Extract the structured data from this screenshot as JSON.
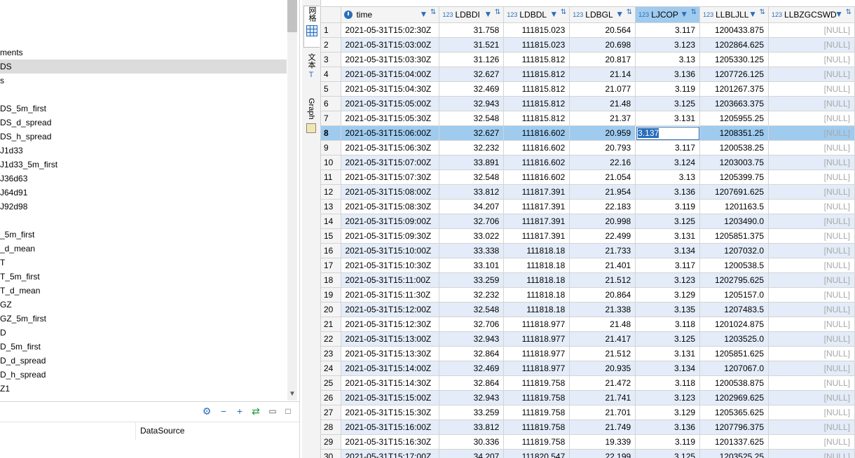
{
  "navigator": {
    "items": [
      {
        "label": "ments",
        "selected": false
      },
      {
        "label": "DS",
        "selected": true
      },
      {
        "label": "s",
        "selected": false
      },
      {
        "label": "",
        "selected": false
      },
      {
        "label": "DS_5m_first",
        "selected": false
      },
      {
        "label": "DS_d_spread",
        "selected": false
      },
      {
        "label": "DS_h_spread",
        "selected": false
      },
      {
        "label": "J1d33",
        "selected": false
      },
      {
        "label": "J1d33_5m_first",
        "selected": false
      },
      {
        "label": "J36d63",
        "selected": false
      },
      {
        "label": "J64d91",
        "selected": false
      },
      {
        "label": "J92d98",
        "selected": false
      },
      {
        "label": "",
        "selected": false
      },
      {
        "label": "_5m_first",
        "selected": false
      },
      {
        "label": "_d_mean",
        "selected": false
      },
      {
        "label": "T",
        "selected": false
      },
      {
        "label": "T_5m_first",
        "selected": false
      },
      {
        "label": "T_d_mean",
        "selected": false
      },
      {
        "label": "GZ",
        "selected": false
      },
      {
        "label": "GZ_5m_first",
        "selected": false
      },
      {
        "label": "D",
        "selected": false
      },
      {
        "label": "D_5m_first",
        "selected": false
      },
      {
        "label": "D_d_spread",
        "selected": false
      },
      {
        "label": "D_h_spread",
        "selected": false
      },
      {
        "label": "Z1",
        "selected": false
      }
    ]
  },
  "bottom_panel": {
    "column_header": "DataSource"
  },
  "vtabs": {
    "grid": "网格",
    "text": "文本",
    "graph": "Graph"
  },
  "grid": {
    "columns": [
      {
        "name": "time",
        "type": "clock"
      },
      {
        "name": "LDBDI",
        "type": "123"
      },
      {
        "name": "LDBDL",
        "type": "123"
      },
      {
        "name": "LDBGL",
        "type": "123"
      },
      {
        "name": "LJCOP",
        "type": "123"
      },
      {
        "name": "LLBLJLL",
        "type": "123"
      },
      {
        "name": "LLBZGCSWD",
        "type": "123"
      }
    ],
    "active_column": "LJCOP",
    "current_row": 8,
    "editing_value": "3.137",
    "null_text": "[NULL]",
    "rows": [
      [
        "1",
        "2021-05-31T15:02:30Z",
        "31.758",
        "111815.023",
        "20.564",
        "3.117",
        "1200433.875"
      ],
      [
        "2",
        "2021-05-31T15:03:00Z",
        "31.521",
        "111815.023",
        "20.698",
        "3.123",
        "1202864.625"
      ],
      [
        "3",
        "2021-05-31T15:03:30Z",
        "31.126",
        "111815.812",
        "20.817",
        "3.13",
        "1205330.125"
      ],
      [
        "4",
        "2021-05-31T15:04:00Z",
        "32.627",
        "111815.812",
        "21.14",
        "3.136",
        "1207726.125"
      ],
      [
        "5",
        "2021-05-31T15:04:30Z",
        "32.469",
        "111815.812",
        "21.077",
        "3.119",
        "1201267.375"
      ],
      [
        "6",
        "2021-05-31T15:05:00Z",
        "32.943",
        "111815.812",
        "21.48",
        "3.125",
        "1203663.375"
      ],
      [
        "7",
        "2021-05-31T15:05:30Z",
        "32.548",
        "111815.812",
        "21.37",
        "3.131",
        "1205955.25"
      ],
      [
        "8",
        "2021-05-31T15:06:00Z",
        "32.627",
        "111816.602",
        "20.959",
        "3.137",
        "1208351.25"
      ],
      [
        "9",
        "2021-05-31T15:06:30Z",
        "32.232",
        "111816.602",
        "20.793",
        "3.117",
        "1200538.25"
      ],
      [
        "10",
        "2021-05-31T15:07:00Z",
        "33.891",
        "111816.602",
        "22.16",
        "3.124",
        "1203003.75"
      ],
      [
        "11",
        "2021-05-31T15:07:30Z",
        "32.548",
        "111816.602",
        "21.054",
        "3.13",
        "1205399.75"
      ],
      [
        "12",
        "2021-05-31T15:08:00Z",
        "33.812",
        "111817.391",
        "21.954",
        "3.136",
        "1207691.625"
      ],
      [
        "13",
        "2021-05-31T15:08:30Z",
        "34.207",
        "111817.391",
        "22.183",
        "3.119",
        "1201163.5"
      ],
      [
        "14",
        "2021-05-31T15:09:00Z",
        "32.706",
        "111817.391",
        "20.998",
        "3.125",
        "1203490.0"
      ],
      [
        "15",
        "2021-05-31T15:09:30Z",
        "33.022",
        "111817.391",
        "22.499",
        "3.131",
        "1205851.375"
      ],
      [
        "16",
        "2021-05-31T15:10:00Z",
        "33.338",
        "111818.18",
        "21.733",
        "3.134",
        "1207032.0"
      ],
      [
        "17",
        "2021-05-31T15:10:30Z",
        "33.101",
        "111818.18",
        "21.401",
        "3.117",
        "1200538.5"
      ],
      [
        "18",
        "2021-05-31T15:11:00Z",
        "33.259",
        "111818.18",
        "21.512",
        "3.123",
        "1202795.625"
      ],
      [
        "19",
        "2021-05-31T15:11:30Z",
        "32.232",
        "111818.18",
        "20.864",
        "3.129",
        "1205157.0"
      ],
      [
        "20",
        "2021-05-31T15:12:00Z",
        "32.548",
        "111818.18",
        "21.338",
        "3.135",
        "1207483.5"
      ],
      [
        "21",
        "2021-05-31T15:12:30Z",
        "32.706",
        "111818.977",
        "21.48",
        "3.118",
        "1201024.875"
      ],
      [
        "22",
        "2021-05-31T15:13:00Z",
        "32.943",
        "111818.977",
        "21.417",
        "3.125",
        "1203525.0"
      ],
      [
        "23",
        "2021-05-31T15:13:30Z",
        "32.864",
        "111818.977",
        "21.512",
        "3.131",
        "1205851.625"
      ],
      [
        "24",
        "2021-05-31T15:14:00Z",
        "32.469",
        "111818.977",
        "20.935",
        "3.134",
        "1207067.0"
      ],
      [
        "25",
        "2021-05-31T15:14:30Z",
        "32.864",
        "111819.758",
        "21.472",
        "3.118",
        "1200538.875"
      ],
      [
        "26",
        "2021-05-31T15:15:00Z",
        "32.943",
        "111819.758",
        "21.741",
        "3.123",
        "1202969.625"
      ],
      [
        "27",
        "2021-05-31T15:15:30Z",
        "33.259",
        "111819.758",
        "21.701",
        "3.129",
        "1205365.625"
      ],
      [
        "28",
        "2021-05-31T15:16:00Z",
        "33.812",
        "111819.758",
        "21.749",
        "3.136",
        "1207796.375"
      ],
      [
        "29",
        "2021-05-31T15:16:30Z",
        "30.336",
        "111819.758",
        "19.339",
        "3.119",
        "1201337.625"
      ],
      [
        "30",
        "2021-05-31T15:17:00Z",
        "34.207",
        "111820.547",
        "22.199",
        "3.125",
        "1203525.25"
      ]
    ]
  },
  "colors": {
    "accent": "#2a6ebb",
    "row_alt": "#e3ecf8",
    "row_selected": "#9fcbef",
    "null_text": "#a8a8a8"
  }
}
